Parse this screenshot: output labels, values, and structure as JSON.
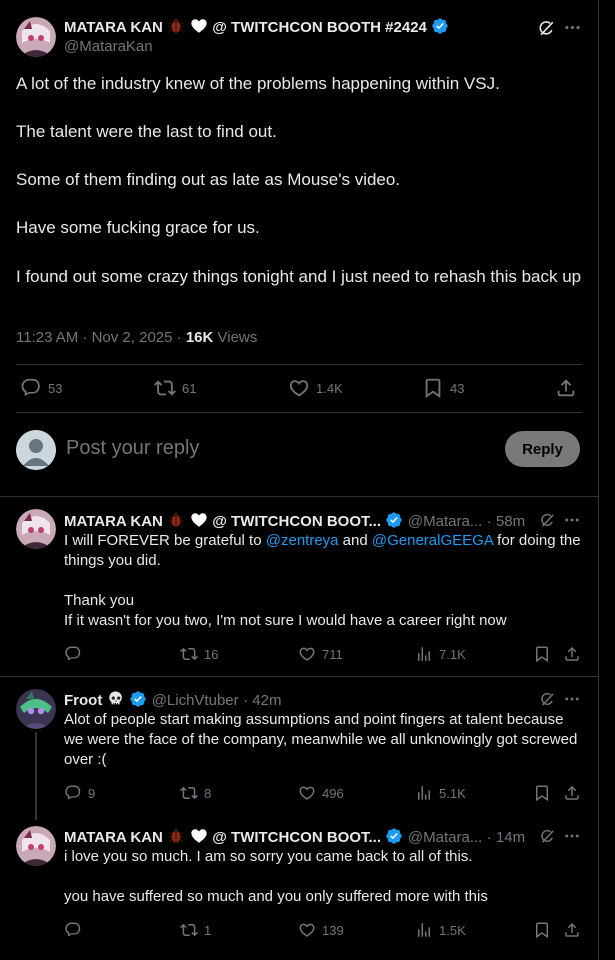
{
  "main_tweet": {
    "display_name": "MATARA KAN",
    "name_suffix": "@ TWITCHCON BOOTH #2424",
    "handle": "@MataraKan",
    "lines": [
      "A lot of the industry knew of the problems happening within VSJ.",
      "The talent were the last to find out.",
      "Some of them finding out as late as Mouse's video.",
      "Have some fucking grace for us.",
      "I found out some crazy things tonight and I just need to rehash this back up"
    ],
    "time": "11:23 AM · Nov 2, 2025 · ",
    "views_count": "16K",
    "views_label": " Views",
    "stats": {
      "replies": "53",
      "reposts": "61",
      "likes": "1.4K",
      "bookmarks": "43"
    }
  },
  "composer": {
    "placeholder": "Post your reply",
    "button": "Reply"
  },
  "replies": [
    {
      "display_name": "MATARA KAN",
      "name_suffix": "@ TWITCHCON BOOT...",
      "handle": "@Matara...",
      "time": "· 58m",
      "text_pre": "I will FOREVER be grateful to ",
      "mention1": "@zentreya",
      "text_mid": " and ",
      "mention2": "@GeneralGEEGA",
      "text_post": " for doing the things you did.",
      "line2": "Thank you",
      "line3": "If it wasn't for you two, I'm not sure I would have a career right now",
      "stats": {
        "replies": "",
        "reposts": "16",
        "likes": "711",
        "views": "7.1K"
      }
    },
    {
      "display_name": "Froot",
      "handle": "@LichVtuber",
      "time": "· 42m",
      "text": "Alot of people start making assumptions and point fingers at talent because we were the face of the company, meanwhile we all unknowingly got screwed over :(",
      "stats": {
        "replies": "9",
        "reposts": "8",
        "likes": "496",
        "views": "5.1K"
      }
    },
    {
      "display_name": "MATARA KAN",
      "name_suffix": "@ TWITCHCON BOOT...",
      "handle": "@Matara...",
      "time": "· 14m",
      "line1": "i love you so much. I am so sorry you came back to all of this.",
      "line2": "you have suffered so much and you only suffered more with this",
      "stats": {
        "replies": "",
        "reposts": "1",
        "likes": "139",
        "views": "1.5K"
      }
    }
  ],
  "colors": {
    "accent": "#1d9bf0",
    "muted": "#71767b",
    "border": "#2f3336",
    "text": "#e7e9ea"
  }
}
